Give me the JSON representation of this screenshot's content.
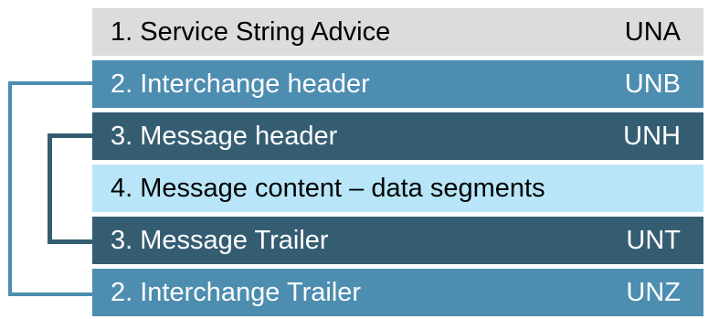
{
  "colors": {
    "light_gray": "#dcdcdc",
    "mid_blue": "#4c8db0",
    "dark_teal": "#355d72",
    "light_cyan": "#b8e6f8",
    "text_dark": "#000000",
    "text_light": "#ffffff"
  },
  "segments": [
    {
      "label": "1. Service String Advice",
      "code": "UNA",
      "bg": "#dcdcdc",
      "fg": "#000000"
    },
    {
      "label": "2. Interchange header",
      "code": "UNB",
      "bg": "#4c8db0",
      "fg": "#ffffff"
    },
    {
      "label": "3. Message header",
      "code": "UNH",
      "bg": "#355d72",
      "fg": "#ffffff"
    },
    {
      "label": "4. Message content – data segments",
      "code": "",
      "bg": "#b8e6f8",
      "fg": "#000000"
    },
    {
      "label": "3. Message Trailer",
      "code": "UNT",
      "bg": "#355d72",
      "fg": "#ffffff"
    },
    {
      "label": "2. Interchange Trailer",
      "code": "UNZ",
      "bg": "#4c8db0",
      "fg": "#ffffff"
    }
  ],
  "brackets": {
    "interchange_color": "#4c8db0",
    "message_color": "#355d72"
  }
}
